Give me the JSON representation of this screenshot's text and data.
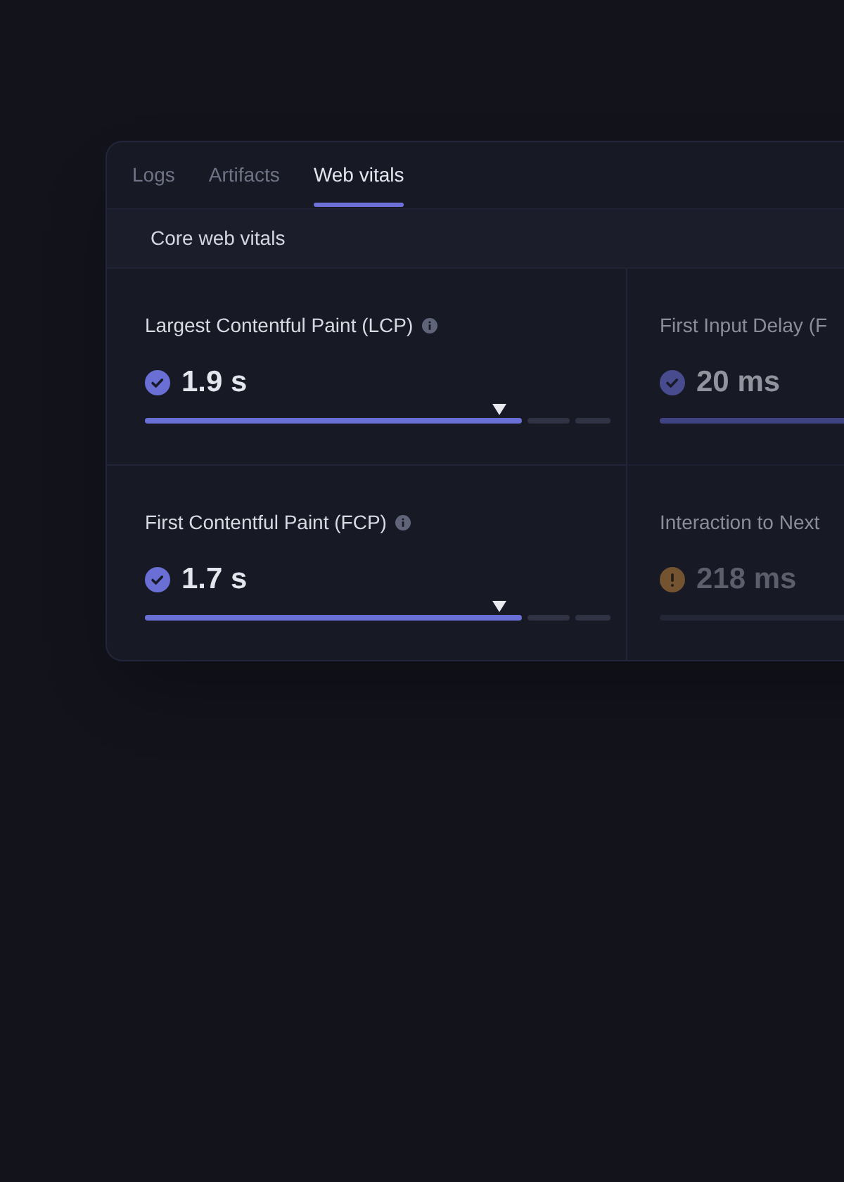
{
  "tabs": [
    {
      "label": "Logs",
      "selected": false
    },
    {
      "label": "Artifacts",
      "selected": false
    },
    {
      "label": "Web vitals",
      "selected": true
    }
  ],
  "section_title": "Core web vitals",
  "metrics": [
    {
      "label": "Largest Contentful Paint (LCP)",
      "info": true,
      "kind": "good",
      "value": "1.9 s",
      "level": 0.76
    },
    {
      "label": "First Input Delay (F",
      "info": false,
      "kind": "good",
      "value": "20 ms"
    },
    {
      "label": "First Contentful Paint (FCP)",
      "info": true,
      "kind": "good",
      "value": "1.7 s",
      "level": 0.76
    },
    {
      "label": "Interaction to Next",
      "info": false,
      "kind": "warning",
      "value": "218 ms"
    }
  ]
}
